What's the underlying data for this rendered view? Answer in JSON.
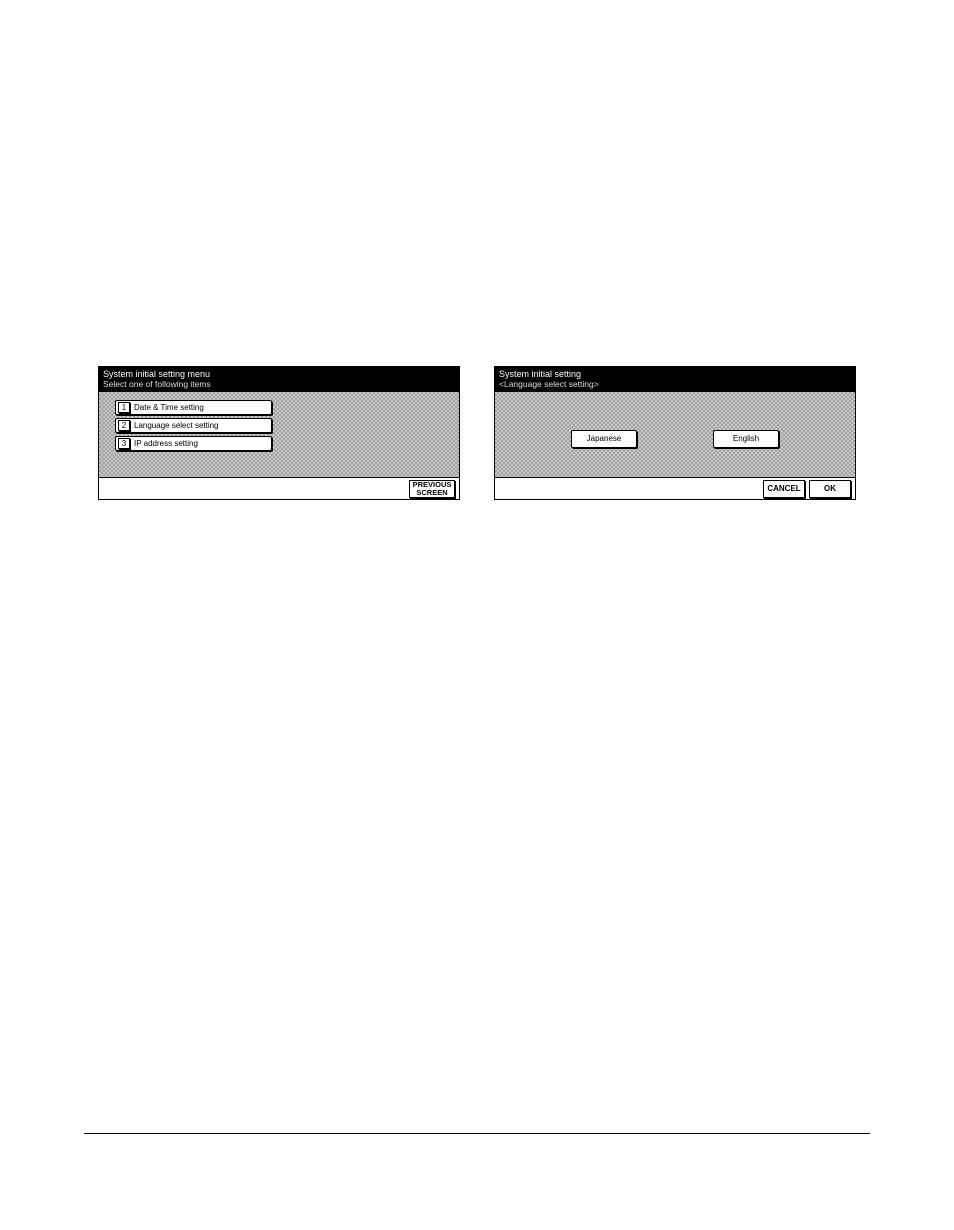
{
  "left_screen": {
    "title_line1": "System initial setting menu",
    "title_line2": "Select one of following items",
    "items": [
      {
        "num": "1",
        "label": "Date & Time setting"
      },
      {
        "num": "2",
        "label": "Language select setting"
      },
      {
        "num": "3",
        "label": "IP address setting"
      }
    ],
    "previous_line1": "PREVIOUS",
    "previous_line2": "SCREEN"
  },
  "right_screen": {
    "title_line1": "System initial setting",
    "title_line2": "<Language select setting>",
    "buttons": {
      "japanese": "Japanese",
      "english": "English"
    },
    "cancel": "CANCEL",
    "ok": "OK"
  }
}
